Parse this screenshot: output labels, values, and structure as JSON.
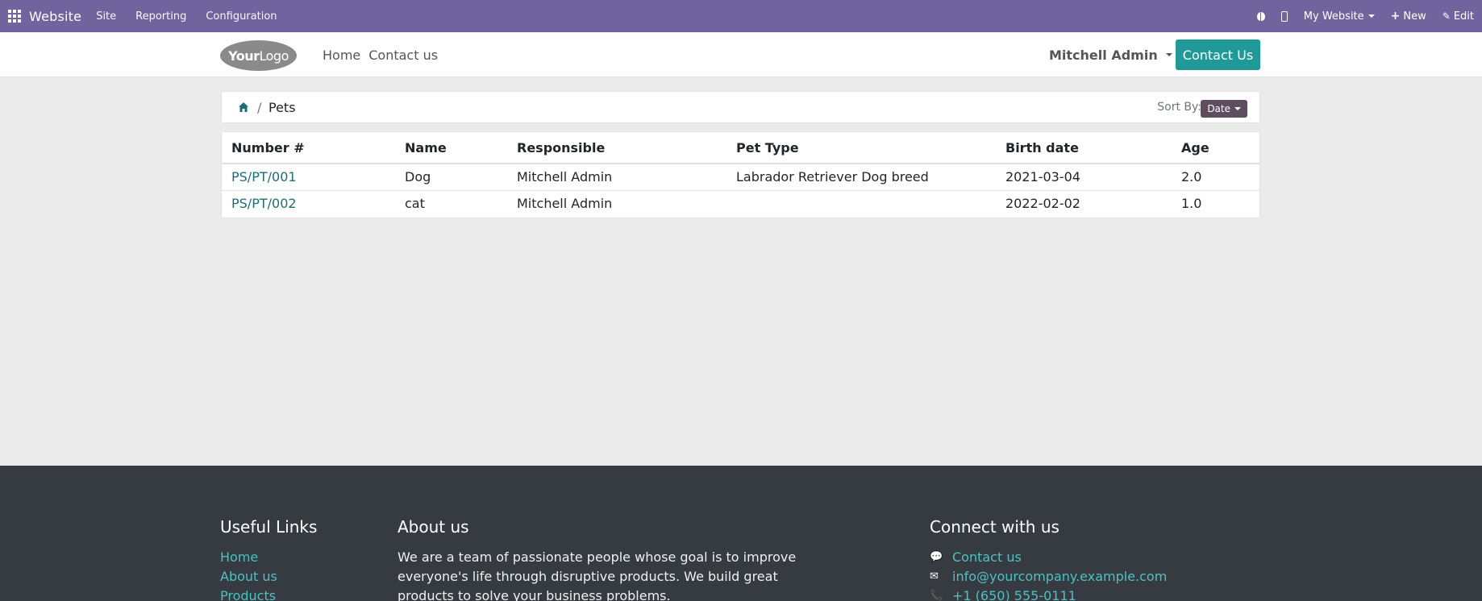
{
  "topbar": {
    "app_name": "Website",
    "menus": [
      "Site",
      "Reporting",
      "Configuration"
    ],
    "website_selector": "My Website",
    "new_label": "New",
    "edit_label": "Edit"
  },
  "header": {
    "logo_a": "Your",
    "logo_b": "Logo",
    "nav": [
      "Home",
      "Contact us"
    ],
    "user": "Mitchell Admin",
    "contact_button": "Contact Us"
  },
  "breadcrumb": {
    "separator": "/",
    "current": "Pets",
    "sort_label": "Sort By:",
    "sort_value": "Date"
  },
  "table": {
    "headers": [
      "Number #",
      "Name",
      "Responsible",
      "Pet Type",
      "Birth date",
      "Age"
    ],
    "rows": [
      [
        "PS/PT/001",
        "Dog",
        "Mitchell Admin",
        "Labrador Retriever Dog breed",
        "2021-03-04",
        "2.0"
      ],
      [
        "PS/PT/002",
        "cat",
        "Mitchell Admin",
        "",
        "2022-02-02",
        "1.0"
      ]
    ]
  },
  "footer": {
    "useful_links_title": "Useful Links",
    "useful_links": [
      "Home",
      "About us",
      "Products"
    ],
    "about_title": "About us",
    "about_text": "We are a team of passionate people whose goal is to improve everyone's life through disruptive products. We build great products to solve your business problems.",
    "connect_title": "Connect with us",
    "connect": {
      "contact": "Contact us",
      "email": "info@yourcompany.example.com",
      "phone": "+1 (650) 555-0111"
    }
  },
  "colors": {
    "topbar": "#71639e",
    "accent": "#1f9a98",
    "link": "#1b6f73",
    "footer_bg": "#363b42"
  }
}
